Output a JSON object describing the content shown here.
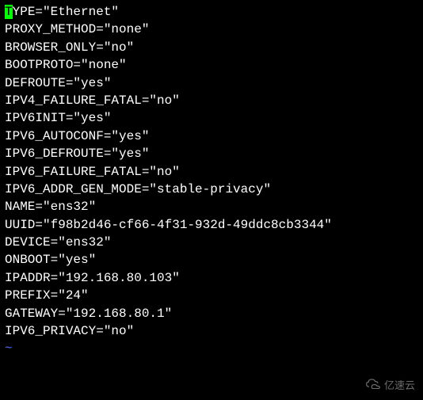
{
  "config_lines": [
    {
      "key": "TYPE",
      "value": "Ethernet",
      "cursor_on_first": true
    },
    {
      "key": "PROXY_METHOD",
      "value": "none"
    },
    {
      "key": "BROWSER_ONLY",
      "value": "no"
    },
    {
      "key": "BOOTPROTO",
      "value": "none"
    },
    {
      "key": "DEFROUTE",
      "value": "yes"
    },
    {
      "key": "IPV4_FAILURE_FATAL",
      "value": "no"
    },
    {
      "key": "IPV6INIT",
      "value": "yes"
    },
    {
      "key": "IPV6_AUTOCONF",
      "value": "yes"
    },
    {
      "key": "IPV6_DEFROUTE",
      "value": "yes"
    },
    {
      "key": "IPV6_FAILURE_FATAL",
      "value": "no"
    },
    {
      "key": "IPV6_ADDR_GEN_MODE",
      "value": "stable-privacy"
    },
    {
      "key": "NAME",
      "value": "ens32"
    },
    {
      "key": "UUID",
      "value": "f98b2d46-cf66-4f31-932d-49ddc8cb3344"
    },
    {
      "key": "DEVICE",
      "value": "ens32"
    },
    {
      "key": "ONBOOT",
      "value": "yes"
    },
    {
      "key": "IPADDR",
      "value": "192.168.80.103"
    },
    {
      "key": "PREFIX",
      "value": "24"
    },
    {
      "key": "GATEWAY",
      "value": "192.168.80.1"
    },
    {
      "key": "IPV6_PRIVACY",
      "value": "no"
    }
  ],
  "tilde": "~",
  "watermark_text": "亿速云"
}
